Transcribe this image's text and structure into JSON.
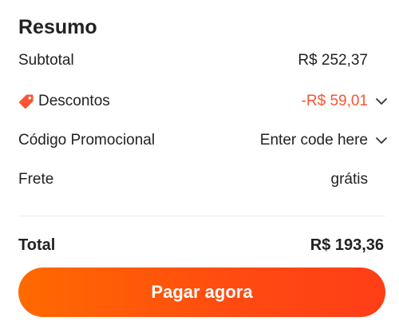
{
  "summary": {
    "title": "Resumo",
    "subtotal_label": "Subtotal",
    "subtotal_value": "R$ 252,37",
    "discount_label": "Descontos",
    "discount_value": "-R$ 59,01",
    "promo_label": "Código Promocional",
    "promo_placeholder": "Enter code here",
    "shipping_label": "Frete",
    "shipping_value": "grátis",
    "total_label": "Total",
    "total_value": "R$ 193,36",
    "pay_button_label": "Pagar agora"
  },
  "icons": {
    "discount": "tag-icon",
    "expand": "chevron-down-icon"
  },
  "colors": {
    "accent": "#ff4f0f",
    "discount": "#fa5533",
    "text": "#222222"
  }
}
